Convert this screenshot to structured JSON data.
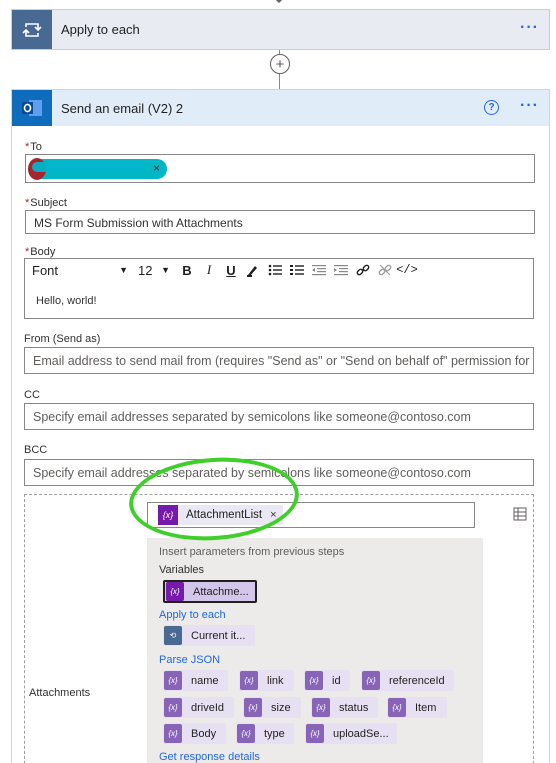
{
  "apply_card": {
    "title": "Apply to each",
    "menu": "···"
  },
  "add_step": {
    "symbol": "+"
  },
  "email_card": {
    "title": "Send an email (V2) 2",
    "help": "?",
    "menu": "···"
  },
  "to": {
    "label": "To",
    "required": "*",
    "remove": "×"
  },
  "subject": {
    "label": "Subject",
    "required": "*",
    "value": "MS Form Submission with Attachments"
  },
  "body": {
    "label": "Body",
    "required": "*",
    "font": "Font",
    "size": "12",
    "bold": "B",
    "italic": "I",
    "underline": "U",
    "code": "</>",
    "value": "Hello, world!"
  },
  "from": {
    "label": "From (Send as)",
    "placeholder": "Email address to send mail from (requires \"Send as\" or \"Send on behalf of\" permission for"
  },
  "cc": {
    "label": "CC",
    "placeholder": "Specify email addresses separated by semicolons like someone@contoso.com"
  },
  "bcc": {
    "label": "BCC",
    "placeholder": "Specify email addresses separated by semicolons like someone@contoso.com"
  },
  "attachments": {
    "label": "Attachments",
    "token": "AttachmentList",
    "token_remove": "×",
    "token_icon": "{x}"
  },
  "dynamic_content": {
    "note": "Insert parameters from previous steps",
    "groups": [
      {
        "title": "Variables",
        "chips": [
          "Attachme..."
        ]
      },
      {
        "title": "Apply to each",
        "chips": [
          "Current it..."
        ]
      },
      {
        "title": "Parse JSON",
        "chips": [
          "name",
          "link",
          "id",
          "referenceId",
          "driveId",
          "size",
          "status",
          "Item",
          "Body",
          "type",
          "uploadSe..."
        ]
      },
      {
        "title": "Get response details",
        "chips": []
      }
    ]
  },
  "colors": {
    "accent": "#2266e3",
    "loop_icon": "#486991",
    "outlook_icon": "#0f6cbd",
    "variable_icon": "#7719aa",
    "json_icon": "#8764b8",
    "annotation_circle": "#3ecf2a",
    "redaction": "#00b4cc"
  }
}
